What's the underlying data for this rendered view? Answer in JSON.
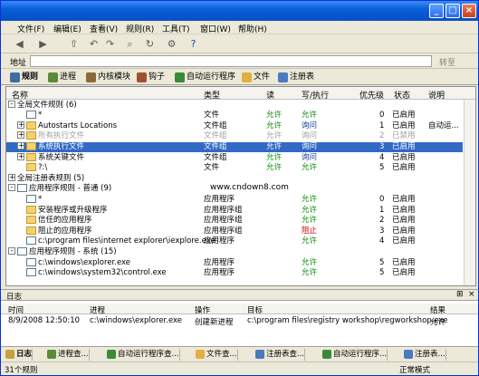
{
  "menu": [
    "文件(F)",
    "编辑(E)",
    "查看(V)",
    "规则(R)",
    "工具(T)",
    "窗口(W)",
    "帮助(H)"
  ],
  "address_label": "地址",
  "goto_label": "转至",
  "tabs": [
    {
      "label": "规则",
      "color": "#3a6ea5"
    },
    {
      "label": "进程",
      "color": "#5a8a3a"
    },
    {
      "label": "内核模块",
      "color": "#8a6a3a"
    },
    {
      "label": "钩子",
      "color": "#a05030"
    },
    {
      "label": "自动运行程序",
      "color": "#3a8a3a"
    },
    {
      "label": "文件",
      "color": "#e0b040"
    },
    {
      "label": "注册表",
      "color": "#4a7ac0"
    }
  ],
  "columns": [
    "名称",
    "类型",
    "读",
    "写/执行",
    "优先级",
    "状态",
    "说明"
  ],
  "rows": [
    {
      "indent": 0,
      "expand": "-",
      "icon": "",
      "name": "全局文件规则 (6)",
      "type": "",
      "read": "",
      "write": "",
      "pri": "",
      "status": "",
      "desc": "",
      "sel": false
    },
    {
      "indent": 1,
      "expand": "",
      "icon": "doc",
      "name": "*",
      "type": "文件",
      "read": "允许",
      "write": "允许",
      "pri": "0",
      "status": "已启用",
      "desc": "",
      "sel": false
    },
    {
      "indent": 1,
      "expand": "+",
      "icon": "folder",
      "name": "Autostarts Locations",
      "type": "文件组",
      "read": "允许",
      "write": "询问",
      "pri": "1",
      "status": "已启用",
      "desc": "自动运...",
      "sel": false
    },
    {
      "indent": 1,
      "expand": "+",
      "icon": "folder",
      "name": "所有执行文件",
      "type": "文件组",
      "read": "允许",
      "write": "询问",
      "pri": "2",
      "status": "已禁用",
      "desc": "",
      "sel": false,
      "gray": true
    },
    {
      "indent": 1,
      "expand": "+",
      "icon": "folder",
      "name": "系统执行文件",
      "type": "文件组",
      "read": "允许",
      "write": "询问",
      "pri": "3",
      "status": "已启用",
      "desc": "",
      "sel": true
    },
    {
      "indent": 1,
      "expand": "+",
      "icon": "folder",
      "name": "系统关键文件",
      "type": "文件组",
      "read": "允许",
      "write": "询问",
      "pri": "4",
      "status": "已启用",
      "desc": "",
      "sel": false
    },
    {
      "indent": 1,
      "expand": "",
      "icon": "folder",
      "name": "?:\\",
      "type": "文件",
      "read": "允许",
      "write": "允许",
      "pri": "5",
      "status": "已启用",
      "desc": "",
      "sel": false
    },
    {
      "indent": 0,
      "expand": "+",
      "icon": "",
      "name": "全局注册表规则 (5)",
      "type": "",
      "read": "",
      "write": "",
      "pri": "",
      "status": "",
      "desc": "",
      "sel": false
    },
    {
      "indent": 0,
      "expand": "-",
      "icon": "doc",
      "name": "应用程序规则 - 普通 (9)",
      "type": "",
      "read": "",
      "write": "",
      "pri": "",
      "status": "",
      "desc": "",
      "sel": false
    },
    {
      "indent": 1,
      "expand": "",
      "icon": "doc",
      "name": "*",
      "type": "应用程序",
      "read": "",
      "write": "允许",
      "pri": "0",
      "status": "已启用",
      "desc": "",
      "sel": false
    },
    {
      "indent": 1,
      "expand": "",
      "icon": "folder",
      "name": "安装程序或升级程序",
      "type": "应用程序组",
      "read": "",
      "write": "允许",
      "pri": "1",
      "status": "已启用",
      "desc": "",
      "sel": false
    },
    {
      "indent": 1,
      "expand": "",
      "icon": "folder",
      "name": "信任的应用程序",
      "type": "应用程序组",
      "read": "",
      "write": "允许",
      "pri": "2",
      "status": "已启用",
      "desc": "",
      "sel": false
    },
    {
      "indent": 1,
      "expand": "",
      "icon": "folder",
      "name": "阻止的应用程序",
      "type": "应用程序组",
      "read": "",
      "write": "阻止",
      "pri": "3",
      "status": "已启用",
      "desc": "",
      "sel": false
    },
    {
      "indent": 1,
      "expand": "",
      "icon": "doc",
      "name": "c:\\program files\\internet explorer\\iexplore.exe",
      "type": "应用程序",
      "read": "",
      "write": "允许",
      "pri": "4",
      "status": "已启用",
      "desc": "",
      "sel": false
    },
    {
      "indent": 0,
      "expand": "-",
      "icon": "doc",
      "name": "应用程序规则 - 系统 (15)",
      "type": "",
      "read": "",
      "write": "",
      "pri": "",
      "status": "",
      "desc": "",
      "sel": false
    },
    {
      "indent": 1,
      "expand": "",
      "icon": "doc",
      "name": "c:\\windows\\explorer.exe",
      "type": "应用程序",
      "read": "",
      "write": "允许",
      "pri": "5",
      "status": "已启用",
      "desc": "",
      "sel": false
    },
    {
      "indent": 1,
      "expand": "",
      "icon": "doc",
      "name": "c:\\windows\\system32\\control.exe",
      "type": "应用程序",
      "read": "",
      "write": "允许",
      "pri": "5",
      "status": "已启用",
      "desc": "",
      "sel": false
    }
  ],
  "watermark": "www.cndown8.com",
  "log": {
    "title": "日志",
    "columns": [
      "时间",
      "进程",
      "操作",
      "目标",
      "结果"
    ],
    "row": [
      "8/9/2008 12:50:10",
      "c:\\windows\\explorer.exe",
      "创建新进程",
      "c:\\program files\\registry workshop\\regworkshop.exe",
      "允许"
    ]
  },
  "bottom_tabs": [
    "日志",
    "进程查...",
    "自动运行程序查...",
    "文件查...",
    "注册表查...",
    "自动运行程序...",
    "注册表..."
  ],
  "status": {
    "left": "31个规则",
    "right": "正常模式"
  }
}
